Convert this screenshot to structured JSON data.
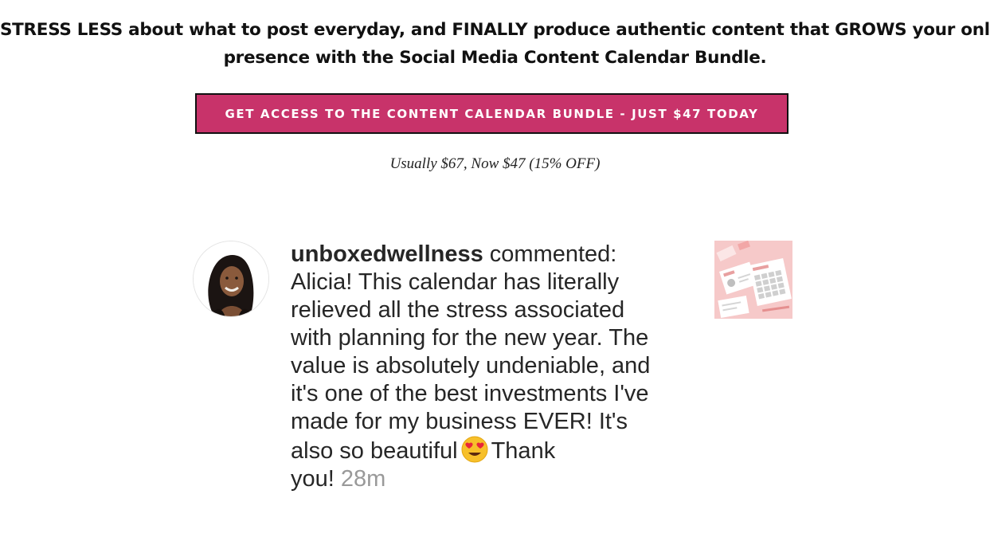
{
  "headline": {
    "line1": "STRESS LESS about what to post everyday, and FINALLY produce authentic content that GROWS your online",
    "line2": "presence with the Social Media Content Calendar Bundle."
  },
  "cta": {
    "label": "GET ACCESS TO THE CONTENT CALENDAR BUNDLE - JUST $47 TODAY"
  },
  "price_note": "Usually $67, Now $47 (15% OFF)",
  "testimonial": {
    "username": "unboxedwellness",
    "action": " commented:",
    "lines": [
      "Alicia! This calendar has literally",
      "relieved all the stress associated",
      "with planning for the new year. The",
      "value is absolutely undeniable, and",
      "it's one of the best investments I've",
      "made for my business EVER! It's",
      "also so beautiful",
      "Thank",
      "you!"
    ],
    "timestamp": "28m",
    "emoji": "heart-eyes-emoji"
  },
  "colors": {
    "cta_background": "#c8336a",
    "text_dark": "#262626",
    "timestamp": "#999999",
    "thumbnail_background": "#f6c9c9"
  }
}
